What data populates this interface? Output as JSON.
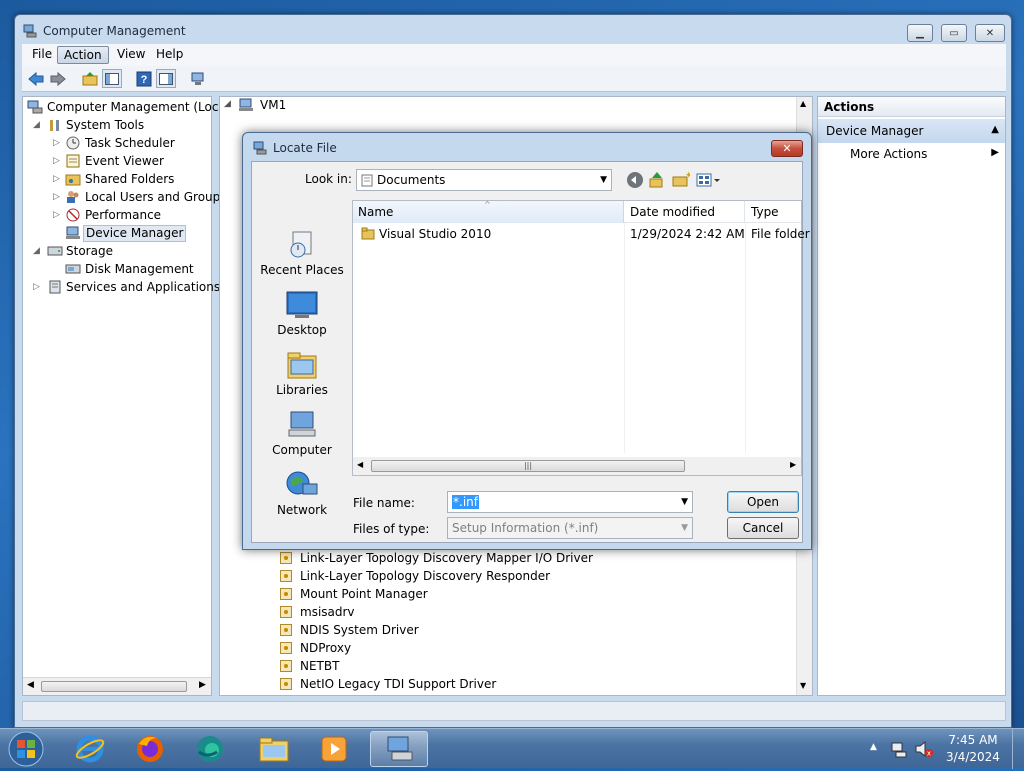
{
  "main_window": {
    "title": "Computer Management",
    "menu": [
      "File",
      "Action",
      "View",
      "Help"
    ],
    "tree": [
      {
        "label": "Computer Management (Local",
        "icon": "computer-management-icon"
      },
      {
        "label": "System Tools",
        "icon": "tools-icon"
      },
      {
        "label": "Task Scheduler",
        "icon": "clock-icon"
      },
      {
        "label": "Event Viewer",
        "icon": "event-viewer-icon"
      },
      {
        "label": "Shared Folders",
        "icon": "shared-folder-icon"
      },
      {
        "label": "Local Users and Groups",
        "icon": "users-icon"
      },
      {
        "label": "Performance",
        "icon": "performance-icon"
      },
      {
        "label": "Device Manager",
        "icon": "device-manager-icon"
      },
      {
        "label": "Storage",
        "icon": "storage-icon"
      },
      {
        "label": "Disk Management",
        "icon": "disk-icon"
      },
      {
        "label": "Services and Applications",
        "icon": "services-icon"
      }
    ],
    "center_header": "VM1",
    "drivers": [
      "Link-Layer Topology Discovery Mapper I/O Driver",
      "Link-Layer Topology Discovery Responder",
      "Mount Point Manager",
      "msisadrv",
      "NDIS System Driver",
      "NDProxy",
      "NETBT",
      "NetIO Legacy TDI Support Driver"
    ],
    "actions": {
      "header": "Actions",
      "section": "Device Manager",
      "items": [
        "More Actions"
      ]
    }
  },
  "dialog": {
    "title": "Locate File",
    "look_in_label": "Look in:",
    "look_in_value": "Documents",
    "places": [
      "Recent Places",
      "Desktop",
      "Libraries",
      "Computer",
      "Network"
    ],
    "columns": [
      "Name",
      "Date modified",
      "Type"
    ],
    "files": [
      {
        "name": "Visual Studio 2010",
        "date": "1/29/2024 2:42 AM",
        "type": "File folder"
      }
    ],
    "file_name_label": "File name:",
    "file_name_value": "*.inf",
    "files_of_type_label": "Files of type:",
    "files_of_type_value": "Setup Information (*.inf)",
    "open_label": "Open",
    "cancel_label": "Cancel"
  },
  "taskbar": {
    "time": "7:45 AM",
    "date": "3/4/2024",
    "apps": [
      "internet-explorer-icon",
      "firefox-icon",
      "edge-icon",
      "file-explorer-icon",
      "media-player-icon",
      "computer-management-icon"
    ]
  },
  "colors": {
    "selection": "#3399ff",
    "accent": "#c7daee"
  }
}
